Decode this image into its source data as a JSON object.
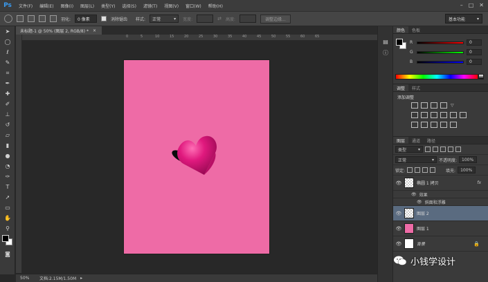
{
  "app": {
    "logo": "Ps"
  },
  "menu": [
    "文件(F)",
    "编辑(E)",
    "图像(I)",
    "图层(L)",
    "类型(Y)",
    "选择(S)",
    "滤镜(T)",
    "视图(V)",
    "窗口(W)",
    "帮助(H)"
  ],
  "options": {
    "feather_label": "羽化:",
    "feather_value": "0 像素",
    "antialias_label": "消除锯齿",
    "style_label": "样式:",
    "style_value": "正常",
    "width_label": "宽度:",
    "height_label": "高度:",
    "refine_button": "调整边缘...",
    "workspace": "基本功能"
  },
  "document": {
    "tab_title": "未标题-1 @ 50% (图层 2, RGB/8) *",
    "zoom": "50%",
    "doc_info": "文档:2.15M/1.50M"
  },
  "ruler_ticks": [
    "0",
    "5",
    "10",
    "15",
    "20",
    "25",
    "30",
    "35",
    "40",
    "45",
    "50",
    "55",
    "60",
    "65"
  ],
  "color_panel": {
    "tabs": [
      "颜色",
      "色板"
    ],
    "channels": [
      {
        "letter": "R",
        "value": "0"
      },
      {
        "letter": "G",
        "value": "0"
      },
      {
        "letter": "B",
        "value": "0"
      }
    ]
  },
  "adjustments_panel": {
    "tabs": [
      "调整",
      "样式"
    ],
    "title": "添加调整"
  },
  "layers_panel": {
    "tabs": [
      "图层",
      "通道",
      "路径"
    ],
    "filter_kind": "类型",
    "blend_mode": "正常",
    "opacity_label": "不透明度:",
    "opacity_value": "100%",
    "lock_label": "锁定:",
    "fill_label": "填充:",
    "fill_value": "100%",
    "layers": [
      {
        "name": "椭圆 1 拷贝",
        "thumb": "checker",
        "fx": "fx",
        "selected": false
      },
      {
        "name": "图层 2",
        "thumb": "checker",
        "fx": "",
        "selected": true
      },
      {
        "name": "图层 1",
        "thumb": "pink",
        "fx": "",
        "selected": false
      },
      {
        "name": "背景",
        "thumb": "white",
        "fx": "",
        "selected": false
      }
    ],
    "effects_label": "效果",
    "effect_name": "斜面和浮雕"
  },
  "watermark": {
    "text": "小钱学设计"
  },
  "colors": {
    "canvas_pink": "#ee6ba6",
    "heart": "#e0197e",
    "selected_layer": "#5a6b80"
  }
}
